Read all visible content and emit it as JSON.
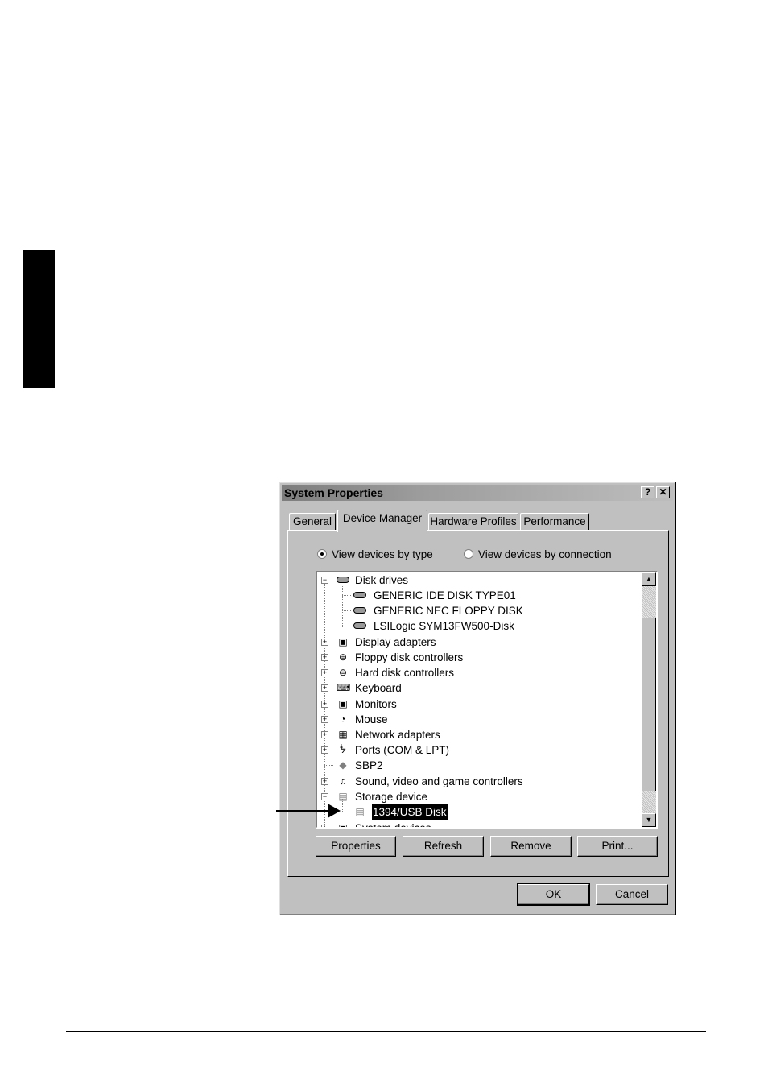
{
  "dialog": {
    "title": "System Properties",
    "help_button": "?",
    "close_button": "✕",
    "tabs": [
      {
        "label": "General",
        "active": false
      },
      {
        "label": "Device Manager",
        "active": true
      },
      {
        "label": "Hardware Profiles",
        "active": false
      },
      {
        "label": "Performance",
        "active": false
      }
    ],
    "view_options": [
      {
        "label": "View devices by type",
        "checked": true
      },
      {
        "label": "View devices by connection",
        "checked": false
      }
    ],
    "tree": [
      {
        "label": "Disk drives",
        "expander": "−",
        "icon": "disk-drive-icon"
      },
      {
        "label": "GENERIC IDE  DISK TYPE01",
        "icon": "disk-drive-icon"
      },
      {
        "label": "GENERIC NEC  FLOPPY DISK",
        "icon": "disk-drive-icon"
      },
      {
        "label": "LSILogic SYM13FW500-Disk",
        "icon": "disk-drive-icon"
      },
      {
        "label": "Display adapters",
        "expander": "+",
        "icon": "display-adapter-icon"
      },
      {
        "label": "Floppy disk controllers",
        "expander": "+",
        "icon": "floppy-controller-icon"
      },
      {
        "label": "Hard disk controllers",
        "expander": "+",
        "icon": "hard-disk-controller-icon"
      },
      {
        "label": "Keyboard",
        "expander": "+",
        "icon": "keyboard-icon"
      },
      {
        "label": "Monitors",
        "expander": "+",
        "icon": "monitor-icon"
      },
      {
        "label": "Mouse",
        "expander": "+",
        "icon": "mouse-icon"
      },
      {
        "label": "Network adapters",
        "expander": "+",
        "icon": "network-adapter-icon"
      },
      {
        "label": "Ports (COM & LPT)",
        "expander": "+",
        "icon": "ports-icon"
      },
      {
        "label": "SBP2",
        "icon": "sbp2-icon"
      },
      {
        "label": "Sound, video and game controllers",
        "expander": "+",
        "icon": "sound-icon"
      },
      {
        "label": "Storage device",
        "expander": "−",
        "icon": "storage-device-icon"
      },
      {
        "label": "1394/USB Disk",
        "icon": "storage-device-icon",
        "selected": true
      },
      {
        "label": "System devices",
        "expander": "+",
        "icon": "system-devices-icon"
      }
    ],
    "buttons": {
      "properties": "Properties",
      "refresh": "Refresh",
      "remove": "Remove",
      "print": "Print...",
      "ok": "OK",
      "cancel": "Cancel"
    }
  }
}
